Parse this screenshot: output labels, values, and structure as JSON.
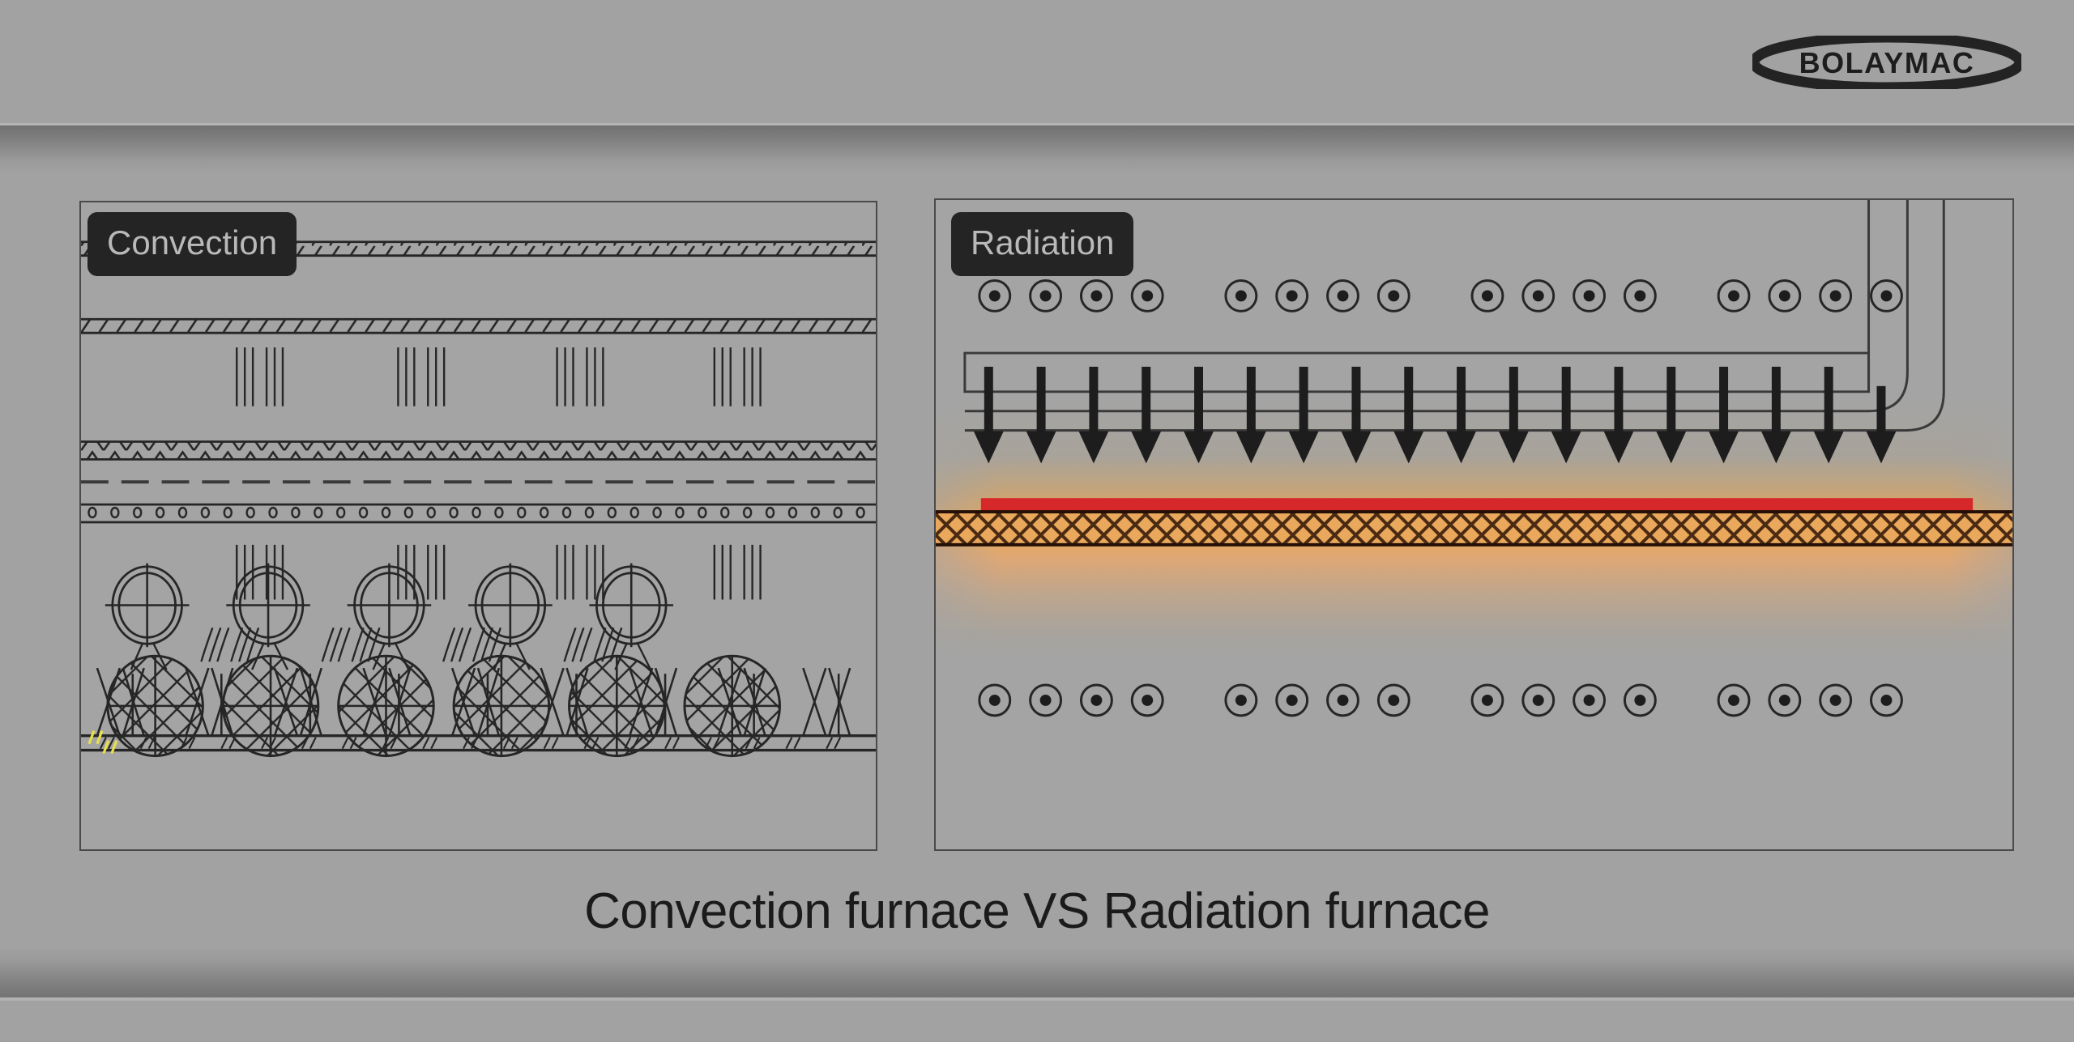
{
  "brand": {
    "logo_text": "BOLAYMAC",
    "logo_name": "bolaymac-logo"
  },
  "caption": "Convection furnace VS Radiation furnace",
  "panels": {
    "convection": {
      "label": "Convection",
      "type": "convection-furnace-cross-section",
      "elements": {
        "hatched_bands": 2,
        "hatch_band_label": "insulated wall hatching",
        "heat_line_groups": 8,
        "heat_line_group_rows": 2,
        "zigzag_band_label": "corrugated baffle",
        "dashed_band_label": "dashed guide line",
        "perforated_band_label": "perforated plate",
        "fan_count": 5,
        "fan_label": "convection fan",
        "airflow_marks": 4,
        "flame_cluster_count": 8,
        "conveyor_label": "conveyor belt",
        "burner_count": 6,
        "burner_label": "mesh burner drum"
      }
    },
    "radiation": {
      "label": "Radiation",
      "type": "radiation-furnace-cross-section",
      "elements": {
        "top_emitter_groups": 4,
        "emitters_per_group": 4,
        "bottom_emitter_groups": 4,
        "bottom_emitters_per_group": 4,
        "emitter_label": "radiant emitter",
        "arrow_count": 18,
        "arrow_label": "radiation heat arrow",
        "duct_label": "return duct",
        "hot_strip_label": "heated workpiece",
        "mesh_band_label": "cross-hatched mesh belt"
      }
    }
  },
  "colors": {
    "page_bg": "#a2a2a2",
    "panel_bg": "#a4a4a4",
    "panel_border": "#4a4a4a",
    "badge_bg": "#242424",
    "badge_text": "#b9b9b9",
    "line": "#262626",
    "caption_text": "#1b1b1b",
    "hot_red": "#d6282a",
    "hot_orange": "#e9a85c",
    "mesh_dark": "#4a2a12",
    "yellow_accent": "#e8e04a"
  }
}
